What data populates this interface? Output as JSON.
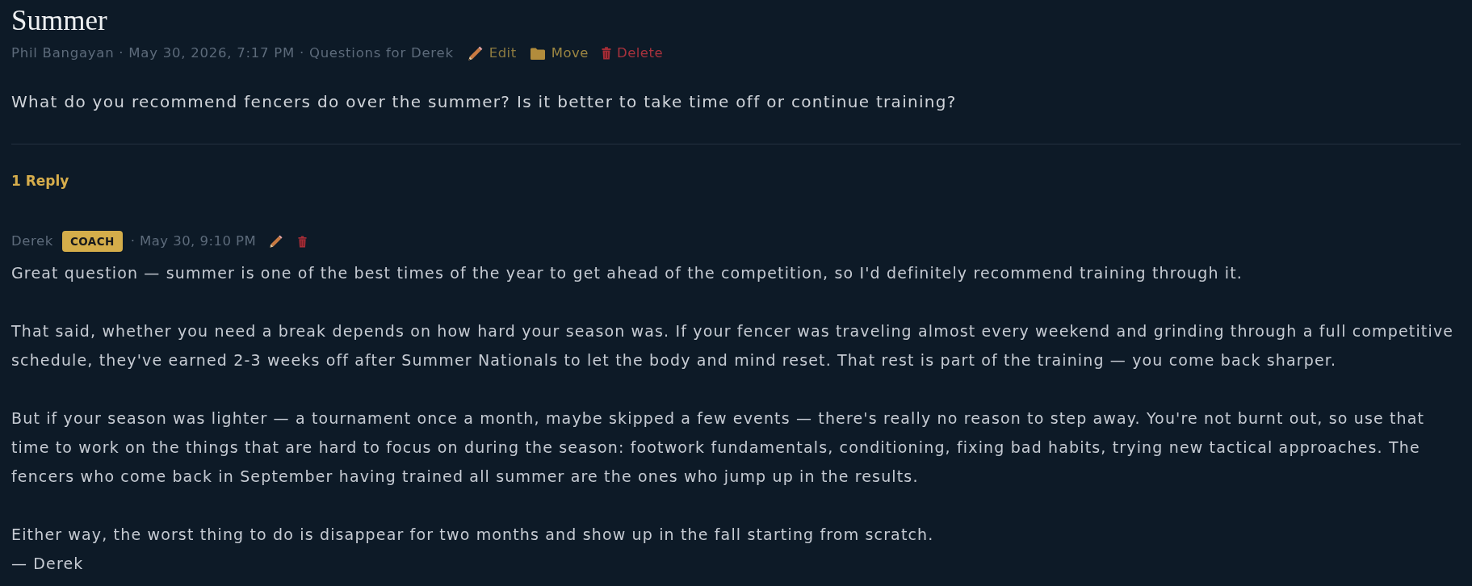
{
  "post": {
    "title": "Summer",
    "meta": "Phil Bangayan · May 30, 2026, 7:17 PM · Questions for Derek",
    "actions": [
      {
        "kind": "edit",
        "label": "Edit"
      },
      {
        "kind": "move",
        "label": "Move"
      },
      {
        "kind": "delete",
        "label": "Delete"
      }
    ],
    "body": "What do you recommend fencers do over the summer? Is it better to take time off or continue training?"
  },
  "replies_heading": "1 Reply",
  "replies": [
    {
      "author": "Derek",
      "badge": "COACH",
      "date": "· May 30, 9:10 PM",
      "actions": [
        {
          "kind": "edit"
        },
        {
          "kind": "delete"
        }
      ],
      "paragraphs": [
        "Great question — summer is one of the best times of the year to get ahead of the competition, so I'd definitely recommend training through it.",
        "That said, whether you need a break depends on how hard your season was. If your fencer was traveling almost every weekend and grinding through a full competitive schedule, they've earned 2-3 weeks off after Summer Nationals to let the body and mind reset. That rest is part of the training — you come back sharper.",
        "But if your season was lighter — a tournament once a month, maybe skipped a few events — there's really no reason to step away. You're not burnt out, so use that time to work on the things that are hard to focus on during the season: footwork fundamentals, conditioning, fixing bad habits, trying new tactical approaches. The fencers who come back in September having trained all summer are the ones who jump up in the results.",
        "Either way, the worst thing to do is disappear for two months and show up in the fall starting from scratch."
      ],
      "signature": "— Derek"
    }
  ]
}
